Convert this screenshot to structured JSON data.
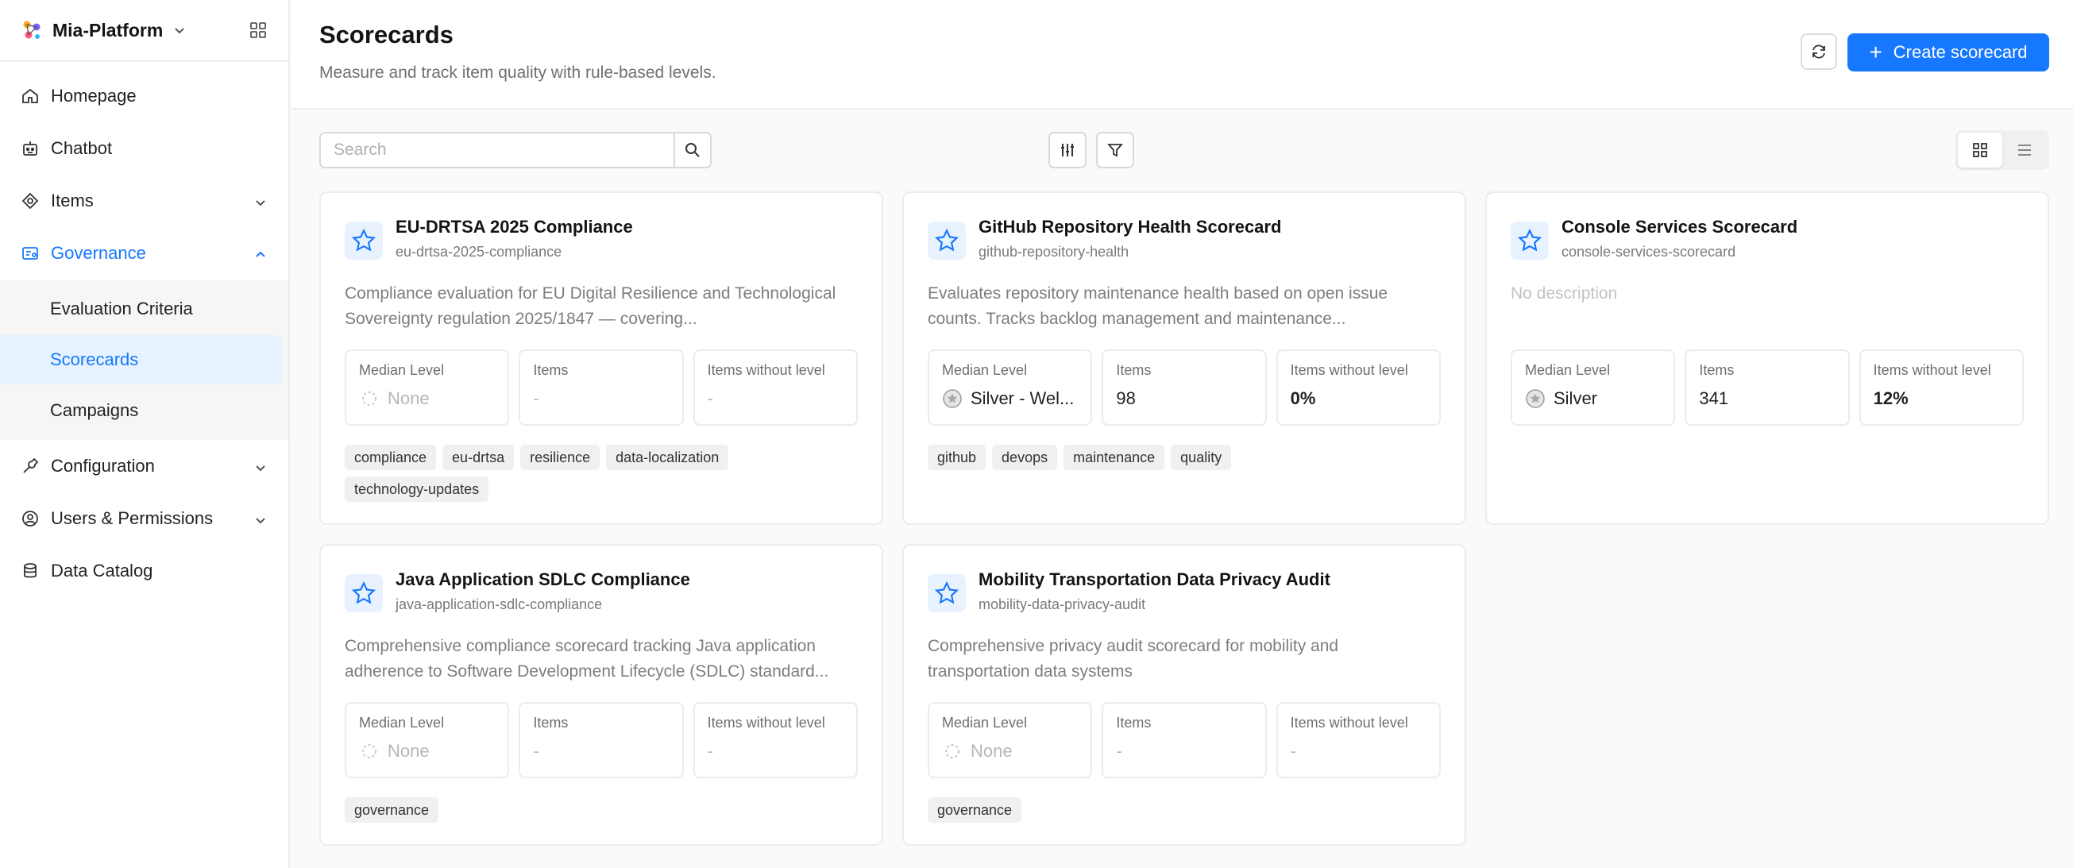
{
  "sidebar": {
    "brand": "Mia-Platform",
    "items": [
      {
        "label": "Homepage"
      },
      {
        "label": "Chatbot"
      },
      {
        "label": "Items"
      },
      {
        "label": "Governance"
      },
      {
        "label": "Configuration"
      },
      {
        "label": "Users & Permissions"
      },
      {
        "label": "Data Catalog"
      }
    ],
    "governance_sub": [
      {
        "label": "Evaluation Criteria"
      },
      {
        "label": "Scorecards"
      },
      {
        "label": "Campaigns"
      }
    ]
  },
  "header": {
    "title": "Scorecards",
    "subtitle": "Measure and track item quality with rule-based levels.",
    "create_label": "Create scorecard"
  },
  "search": {
    "placeholder": "Search"
  },
  "stat_labels": {
    "median": "Median Level",
    "items": "Items",
    "without": "Items without level"
  },
  "cards": [
    {
      "title": "EU-DRTSA 2025 Compliance",
      "slug": "eu-drtsa-2025-compliance",
      "description": "Compliance evaluation for EU Digital Resilience and Technological Sovereignty regulation 2025/1847 — covering...",
      "median": "None",
      "items": "-",
      "without": "-",
      "tags": [
        "compliance",
        "eu-drtsa",
        "resilience",
        "data-localization",
        "technology-updates"
      ]
    },
    {
      "title": "GitHub Repository Health Scorecard",
      "slug": "github-repository-health",
      "description": "Evaluates repository maintenance health based on open issue counts. Tracks backlog management and maintenance...",
      "median": "Silver - Wel...",
      "items": "98",
      "without": "0%",
      "tags": [
        "github",
        "devops",
        "maintenance",
        "quality"
      ]
    },
    {
      "title": "Console Services Scorecard",
      "slug": "console-services-scorecard",
      "description": "No description",
      "median": "Silver",
      "items": "341",
      "without": "12%",
      "tags": []
    },
    {
      "title": "Java Application SDLC Compliance",
      "slug": "java-application-sdlc-compliance",
      "description": "Comprehensive compliance scorecard tracking Java application adherence to Software Development Lifecycle (SDLC) standard...",
      "median": "None",
      "items": "-",
      "without": "-",
      "tags": [
        "governance"
      ]
    },
    {
      "title": "Mobility Transportation Data Privacy Audit",
      "slug": "mobility-data-privacy-audit",
      "description": "Comprehensive privacy audit scorecard for mobility and transportation data systems",
      "median": "None",
      "items": "-",
      "without": "-",
      "tags": [
        "governance"
      ]
    }
  ],
  "colors": {
    "accent": "#1677ff",
    "selected_bg": "#e6f2ff"
  }
}
